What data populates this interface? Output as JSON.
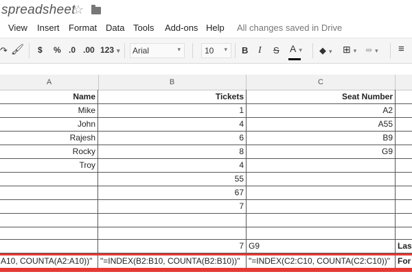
{
  "doc": {
    "title": "spreadsheet"
  },
  "menu": {
    "items": [
      "View",
      "Insert",
      "Format",
      "Data",
      "Tools",
      "Add-ons",
      "Help"
    ],
    "status": "All changes saved in Drive"
  },
  "toolbar": {
    "currency": "$",
    "percent": "%",
    "dec_less": ".0",
    "dec_more": ".00",
    "number_format": "123",
    "font": "Arial",
    "size": "10",
    "bold": "B",
    "italic": "I",
    "strike": "S",
    "text_color": "A",
    "text_color_value": "#000000"
  },
  "columns": [
    "A",
    "B",
    "C"
  ],
  "rows": [
    {
      "a": "Name",
      "b": "Tickets",
      "c": "Seat Number",
      "d": "",
      "header": true
    },
    {
      "a": "Mike",
      "b": "1",
      "c": "A2",
      "d": ""
    },
    {
      "a": "John",
      "b": "4",
      "c": "A55",
      "d": ""
    },
    {
      "a": "Rajesh",
      "b": "6",
      "c": "B9",
      "d": ""
    },
    {
      "a": "Rocky",
      "b": "8",
      "c": "G9",
      "d": ""
    },
    {
      "a": "Troy",
      "b": "4",
      "c": "",
      "d": ""
    },
    {
      "a": "",
      "b": "55",
      "c": "",
      "d": ""
    },
    {
      "a": "",
      "b": "67",
      "c": "",
      "d": ""
    },
    {
      "a": "",
      "b": "7",
      "c": "",
      "d": ""
    },
    {
      "a": "",
      "b": "",
      "c": "",
      "d": ""
    },
    {
      "a": "",
      "b": "",
      "c": "",
      "d": ""
    },
    {
      "a": "",
      "b": "7",
      "c": "G9",
      "d": "Las"
    },
    {
      "a": "A10, COUNTA(A2:A10))\"",
      "b": "\"=INDEX(B2:B10, COUNTA(B2:B10))\"",
      "c": "\"=INDEX(C2:C10, COUNTA(C2:C10))\"",
      "d": "For"
    }
  ],
  "accent": "#e53935"
}
